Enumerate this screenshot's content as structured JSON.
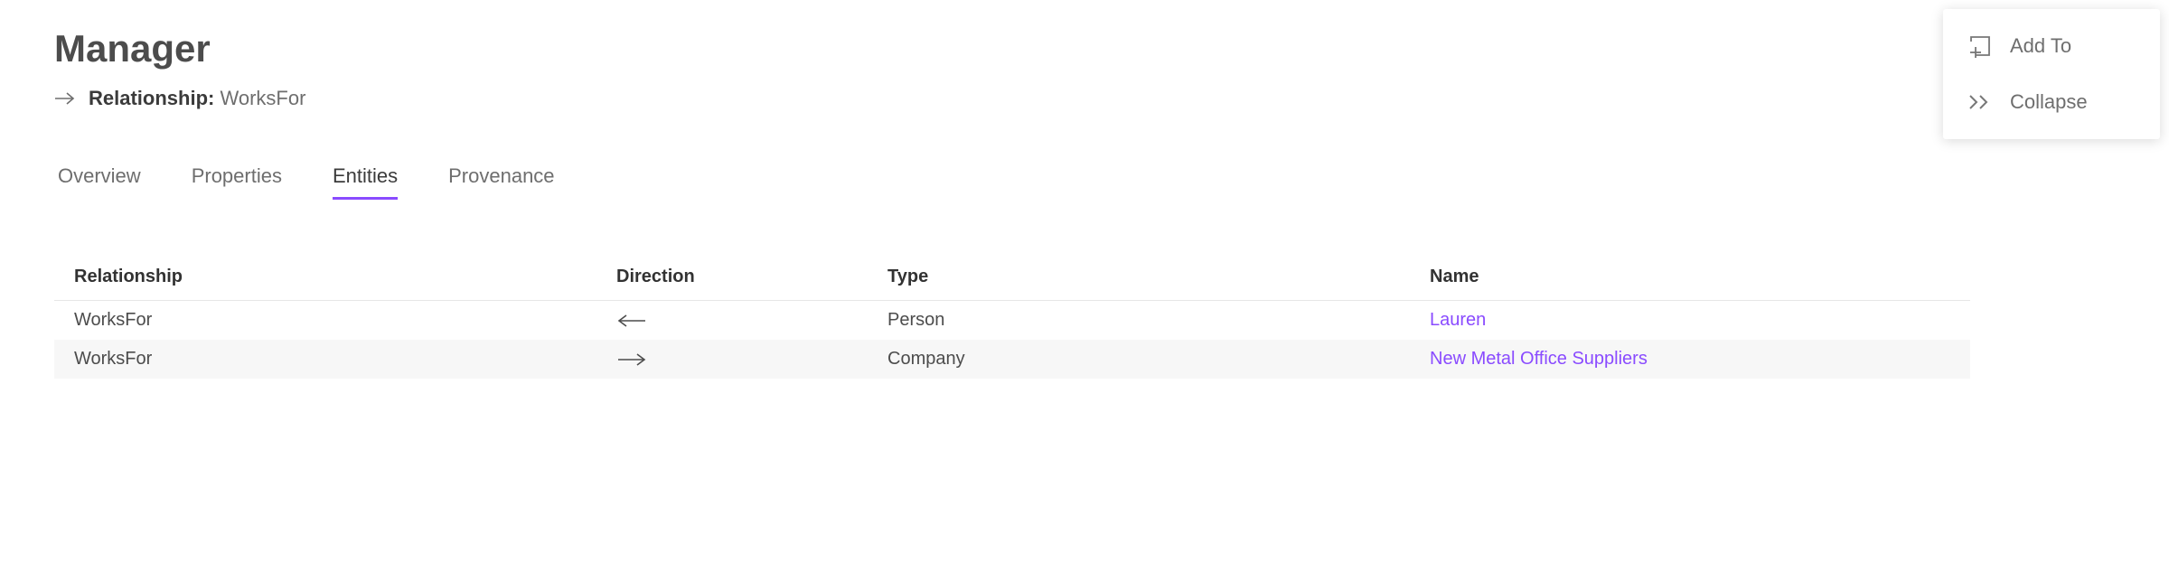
{
  "header": {
    "title": "Manager",
    "relationship_label": "Relationship:",
    "relationship_value": "WorksFor"
  },
  "tabs": [
    {
      "label": "Overview",
      "active": false
    },
    {
      "label": "Properties",
      "active": false
    },
    {
      "label": "Entities",
      "active": true
    },
    {
      "label": "Provenance",
      "active": false
    }
  ],
  "table": {
    "columns": [
      "Relationship",
      "Direction",
      "Type",
      "Name"
    ],
    "rows": [
      {
        "relationship": "WorksFor",
        "direction": "left",
        "type": "Person",
        "name": "Lauren"
      },
      {
        "relationship": "WorksFor",
        "direction": "right",
        "type": "Company",
        "name": "New Metal Office Suppliers"
      }
    ]
  },
  "panel": {
    "add_to": "Add To",
    "collapse": "Collapse"
  },
  "colors": {
    "accent": "#8a4bff"
  }
}
